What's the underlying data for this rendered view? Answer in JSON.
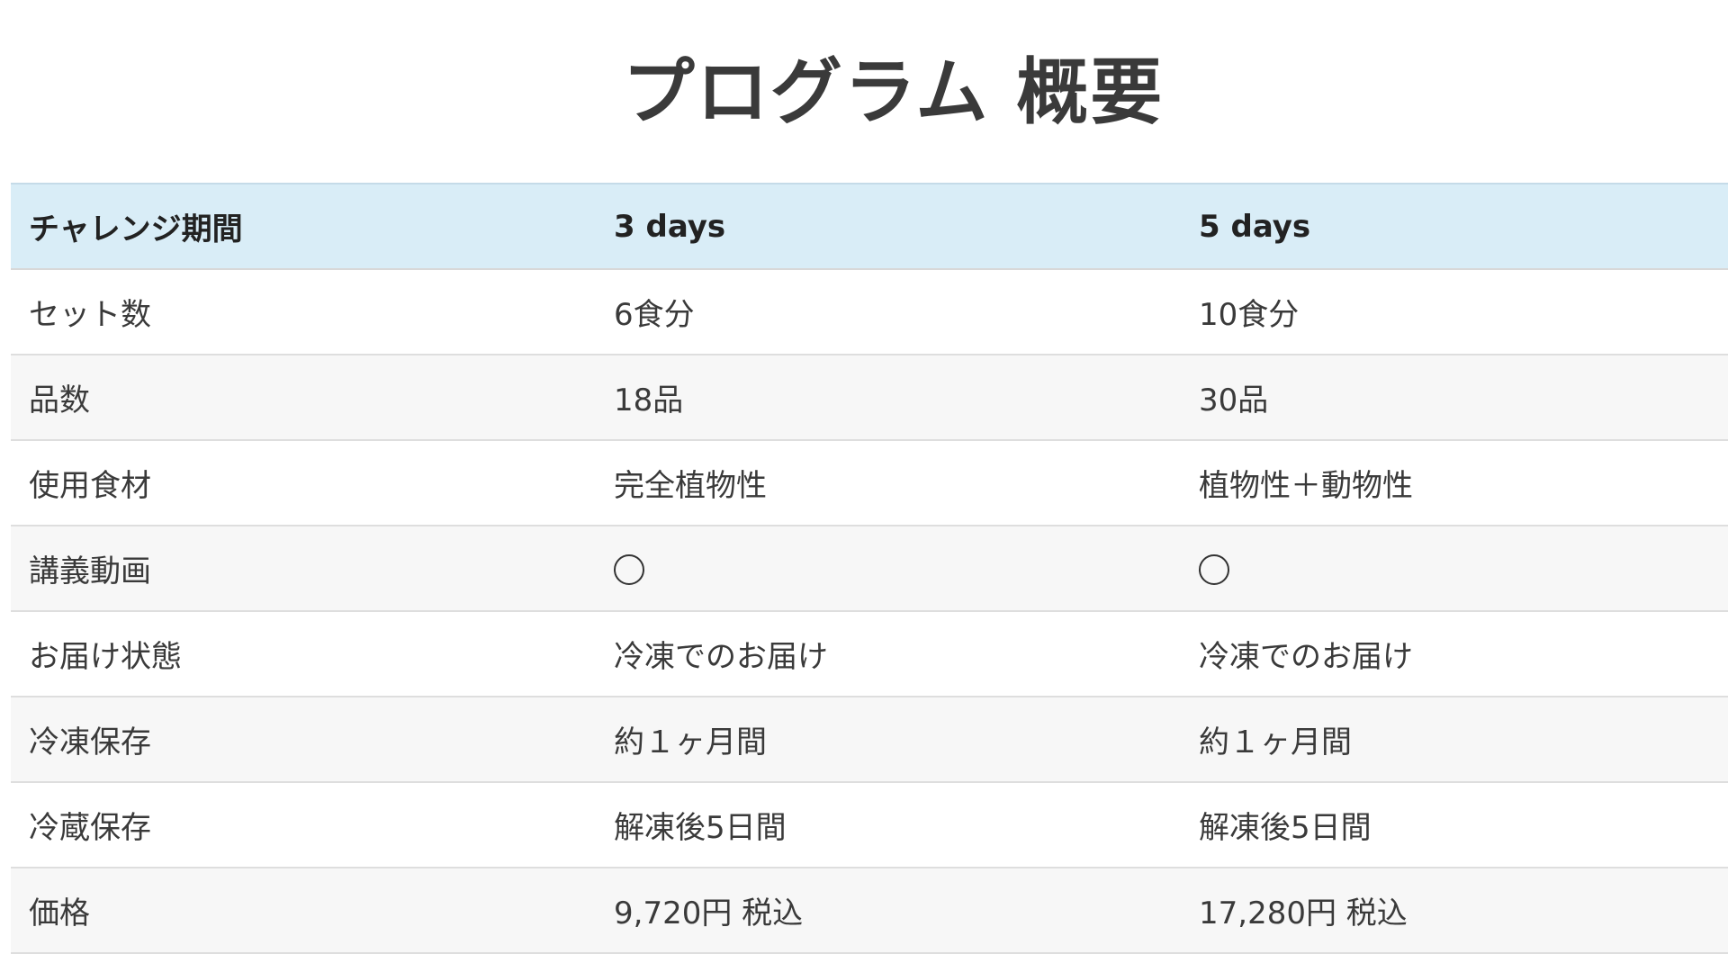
{
  "page": {
    "title": "プログラム 概要"
  },
  "table": {
    "headers": [
      "チャレンジ期間",
      "3 days",
      "5 days"
    ],
    "rows": [
      [
        "セット数",
        "6食分",
        "10食分"
      ],
      [
        "品数",
        "18品",
        "30品"
      ],
      [
        "使用食材",
        "完全植物性",
        "植物性＋動物性"
      ],
      [
        "講義動画",
        "○",
        "○"
      ],
      [
        "お届け状態",
        "冷凍でのお届け",
        "冷凍でのお届け"
      ],
      [
        "冷凍保存",
        "約１ヶ月間",
        "約１ヶ月間"
      ],
      [
        "冷蔵保存",
        "解凍後5日間",
        "解凍後5日間"
      ],
      [
        "価格",
        "9,720円 税込",
        "17,280円 税込"
      ]
    ]
  },
  "colors": {
    "header_bg": "#d9edf7",
    "stripe_bg": "#f7f7f7",
    "text": "#333333"
  },
  "icons": {
    "available": "circle-icon"
  }
}
